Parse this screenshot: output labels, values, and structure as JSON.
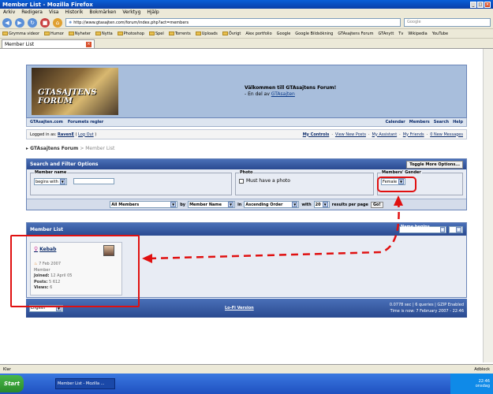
{
  "window": {
    "title": "Member List - Mozilla Firefox"
  },
  "menu": [
    "Arkiv",
    "Redigera",
    "Visa",
    "Historik",
    "Bokmärken",
    "Verktyg",
    "Hjälp"
  ],
  "nav": {
    "url": "http://www.gtasajten.com/forum/index.php?act=members",
    "search_placeholder": "Google"
  },
  "bookmarks": [
    "Grymma videor",
    "Humor",
    "Nyheter",
    "Nytta",
    "Photoshop",
    "Spel",
    "Torrents",
    "Uploads",
    "Övrigt",
    "Alex portfolio",
    "Google",
    "Google Bildsökning",
    "GTAsajtens Forum",
    "GTAnytt",
    "Tv",
    "Wikipedia",
    "YouTube"
  ],
  "tab": {
    "label": "Member List"
  },
  "forum": {
    "logo_text": "GTASAJTENS FORUM",
    "welcome_line1": "Välkommen till GTAsajtens Forum!",
    "welcome_line2_prefix": "- En del av",
    "welcome_link": "GTAsajten",
    "nav_left": [
      "GTAsajten.com",
      "Forumets regler"
    ],
    "nav_right": [
      "Calendar",
      "Members",
      "Search",
      "Help"
    ],
    "logged_prefix": "Logged in as:",
    "logged_user": "RavenE",
    "logout": "Log Out",
    "user_links": [
      "My Controls",
      "View New Posts",
      "My Assistant",
      "My Friends",
      "0 New Messages"
    ],
    "breadcrumb": {
      "root": "GTAsajtens Forum",
      "current": "Member List"
    }
  },
  "filter": {
    "title": "Search and Filter Options",
    "toggle": "Toggle More Options...",
    "member_name_legend": "Member name",
    "member_name_mode": "begins with",
    "photo_legend": "Photo",
    "photo_label": "Must have a photo",
    "gender_legend": "Members' Gender",
    "gender_value": "Female",
    "group": "All Members",
    "by": "by",
    "sort_field": "Member Name",
    "in": "in",
    "order": "Ascending Order",
    "with": "with",
    "per_page": "20",
    "results_label": "results per page",
    "go": "Go!"
  },
  "member_list": {
    "title": "Member List",
    "name_filter": "Name begins with...",
    "letter": "a",
    "member": {
      "name": "Kebab",
      "date": "7 Feb 2007",
      "group": "Member",
      "joined_label": "Joined:",
      "joined": "12 April 05",
      "posts_label": "Posts:",
      "posts": "5 612",
      "views_label": "Views:",
      "views": "6"
    }
  },
  "footer": {
    "language": "English",
    "lofi": "Lo-Fi Version",
    "stats_line1": "0.0778 sec  |  6 queries  |  GZIP Enabled",
    "stats_line2": "Time is now: 7 February 2007 - 22:46"
  },
  "status": {
    "left": "Klar",
    "right": "Adblock"
  },
  "taskbar": {
    "start": "Start",
    "task": "Member List - Mozilla ...",
    "time": "22:46",
    "day": "onsdag"
  },
  "colors": {
    "annotation": "#e01010",
    "forum_header": "#4a70b8"
  }
}
